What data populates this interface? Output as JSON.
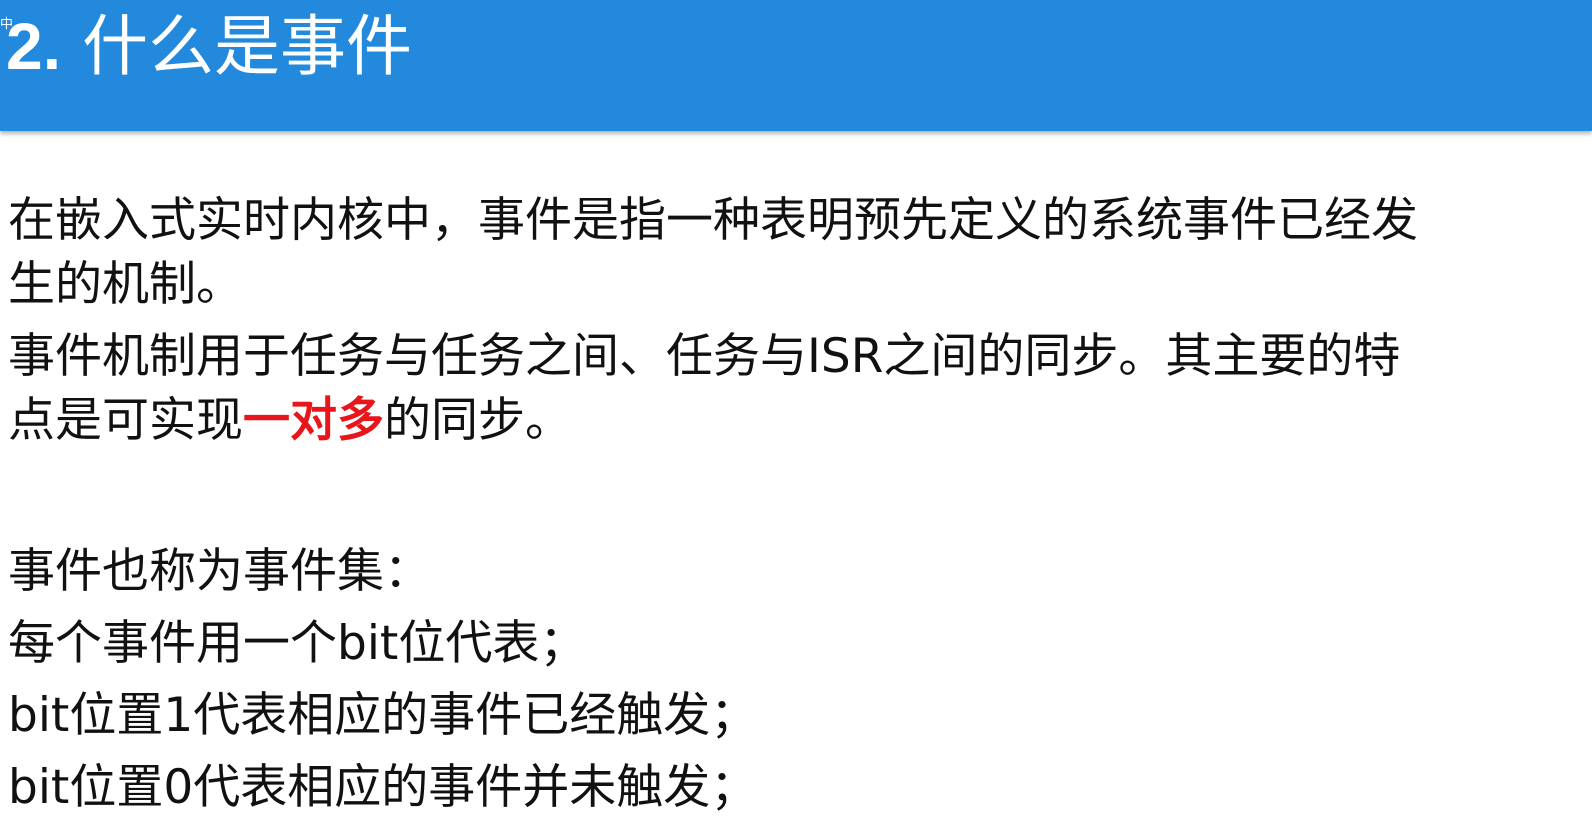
{
  "header": {
    "corner_mark": "中",
    "title_number": "2.",
    "title_text": "什么是事件",
    "color": "#2389dc"
  },
  "content": {
    "para1": {
      "line1": "在嵌入式实时内核中，事件是指一种表明预先定义的系统事件已经发",
      "line2": "生的机制。"
    },
    "para2": {
      "line1": "事件机制用于任务与任务之间、任务与ISR之间的同步。其主要的特",
      "line2_before": "点是可实现",
      "line2_emphasis": "一对多",
      "line2_after": "的同步。",
      "emphasis_color": "#e8161b"
    },
    "list": {
      "line1": "事件也称为事件集：",
      "line2": "每个事件用一个bit位代表；",
      "line3": "bit位置1代表相应的事件已经触发；",
      "line4": "bit位置0代表相应的事件并未触发；"
    }
  }
}
